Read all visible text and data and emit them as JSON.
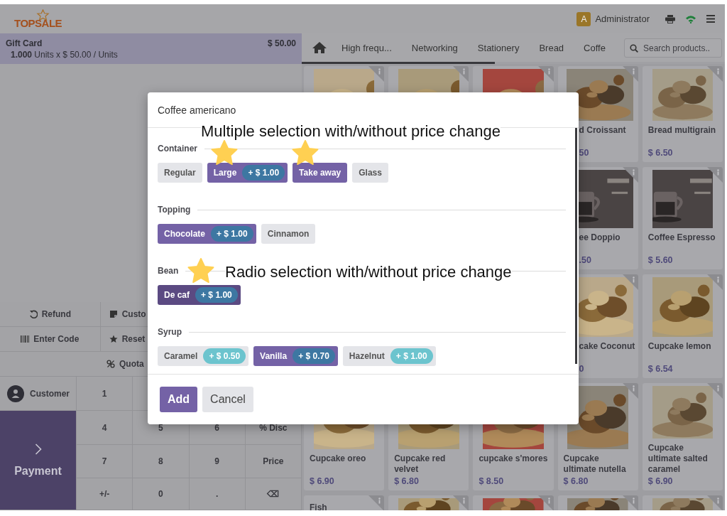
{
  "header": {
    "logo": "TOPSALE",
    "user_initial": "A",
    "user_name": "Administrator"
  },
  "order": {
    "lines": [
      {
        "name": "Gift Card",
        "price": "$ 50.00",
        "quantity": "1.000",
        "detail": "Units x $ 50.00 / Units",
        "selected": true
      }
    ]
  },
  "actions": [
    {
      "label": "Refund",
      "kind": "refund"
    },
    {
      "label": "Custo",
      "kind": "note"
    },
    {
      "label": "Enter Code",
      "kind": "barcode"
    },
    {
      "label": "Reset",
      "kind": "star"
    },
    {
      "label": "Quota",
      "kind": "link"
    }
  ],
  "numpad": {
    "customer": "Customer",
    "payment": "Payment",
    "rows": [
      [
        "1"
      ],
      [
        "4",
        "5",
        "6",
        "% Disc"
      ],
      [
        "7",
        "8",
        "9",
        "Price"
      ],
      [
        "+/-",
        "0",
        ".",
        "⌫"
      ]
    ]
  },
  "categories": {
    "tabs": [
      "High frequ...",
      "Networking",
      "Stationery",
      "Bread",
      "Coffe"
    ],
    "search_placeholder": "Search products.."
  },
  "products": [
    [
      {
        "kind": "top-only",
        "image": true
      },
      {
        "kind": "top-only",
        "image": true
      },
      {
        "kind": "top-only",
        "image": true
      },
      {
        "kind": "right-part",
        "image": true,
        "name": "d Croissant",
        "price": "50"
      },
      {
        "kind": "full",
        "image": true,
        "name": "Bread multigrain",
        "price": "$ 6.50"
      }
    ],
    [
      {
        "kind": "right-part",
        "image": true,
        "name": "ee Doppio",
        "price": ".50"
      },
      {
        "kind": "full",
        "image": true,
        "name": "Coffee Espresso",
        "price": "$ 5.60"
      }
    ],
    [
      {
        "kind": "right-part",
        "image": true,
        "name": "cake Coconut",
        "price": "0"
      },
      {
        "kind": "full",
        "image": true,
        "name": "Cupcake lemon",
        "price": "$ 6.54"
      }
    ],
    [
      {
        "kind": "bottom-part",
        "image": true,
        "name": "Cupcake oreo",
        "price": "$ 6.90"
      },
      {
        "kind": "bottom-part",
        "image": true,
        "name": "Cupcake red velvet",
        "price": "$ 6.80"
      },
      {
        "kind": "bottom-part",
        "image": true,
        "name": "cupcake s'mores",
        "price": "$ 8.50"
      },
      {
        "kind": "full",
        "image": true,
        "name": "Cupcake ultimate nutella",
        "price": "$ 6.80"
      },
      {
        "kind": "full",
        "image": true,
        "name": "Cupcake ultimate salted caramel",
        "price": "$ 6.90"
      }
    ],
    [
      {
        "kind": "full",
        "image": false,
        "name": "Fish"
      },
      {
        "kind": "full",
        "image": true
      },
      {
        "kind": "full",
        "image": true
      },
      {
        "kind": "full",
        "image": true
      },
      {
        "kind": "full",
        "image": true
      }
    ]
  ],
  "dialog": {
    "title": "Coffee americano",
    "sections": [
      {
        "label": "Container",
        "kind": "multiple",
        "options": [
          {
            "label": "Regular",
            "selected": false
          },
          {
            "label": "Large",
            "price": "+ $ 1.00",
            "selected": true
          },
          {
            "label": "Take away",
            "selected": true
          },
          {
            "label": "Glass",
            "selected": false
          }
        ]
      },
      {
        "label": "Topping",
        "kind": "multiple",
        "options": [
          {
            "label": "Chocolate",
            "price": "+ $ 1.00",
            "selected": true
          },
          {
            "label": "Cinnamon",
            "selected": false
          }
        ]
      },
      {
        "label": "Bean",
        "kind": "radio",
        "options": [
          {
            "label": "De caf",
            "price": "+ $ 1.00",
            "selected": true
          }
        ]
      },
      {
        "label": "Syrup",
        "kind": "multiple",
        "options": [
          {
            "label": "Caramel",
            "price": "+ $ 0.50",
            "selected": false
          },
          {
            "label": "Vanilla",
            "price": "+ $ 0.70",
            "selected": true
          },
          {
            "label": "Hazelnut",
            "price": "+ $ 1.00",
            "selected": false
          }
        ]
      }
    ],
    "buttons": [
      {
        "label": "Add",
        "kind": "primary"
      },
      {
        "label": "Cancel",
        "kind": "secondary"
      }
    ]
  },
  "annotations": [
    "Multiple selection with/without price change",
    "Radio selection with/without price change"
  ]
}
